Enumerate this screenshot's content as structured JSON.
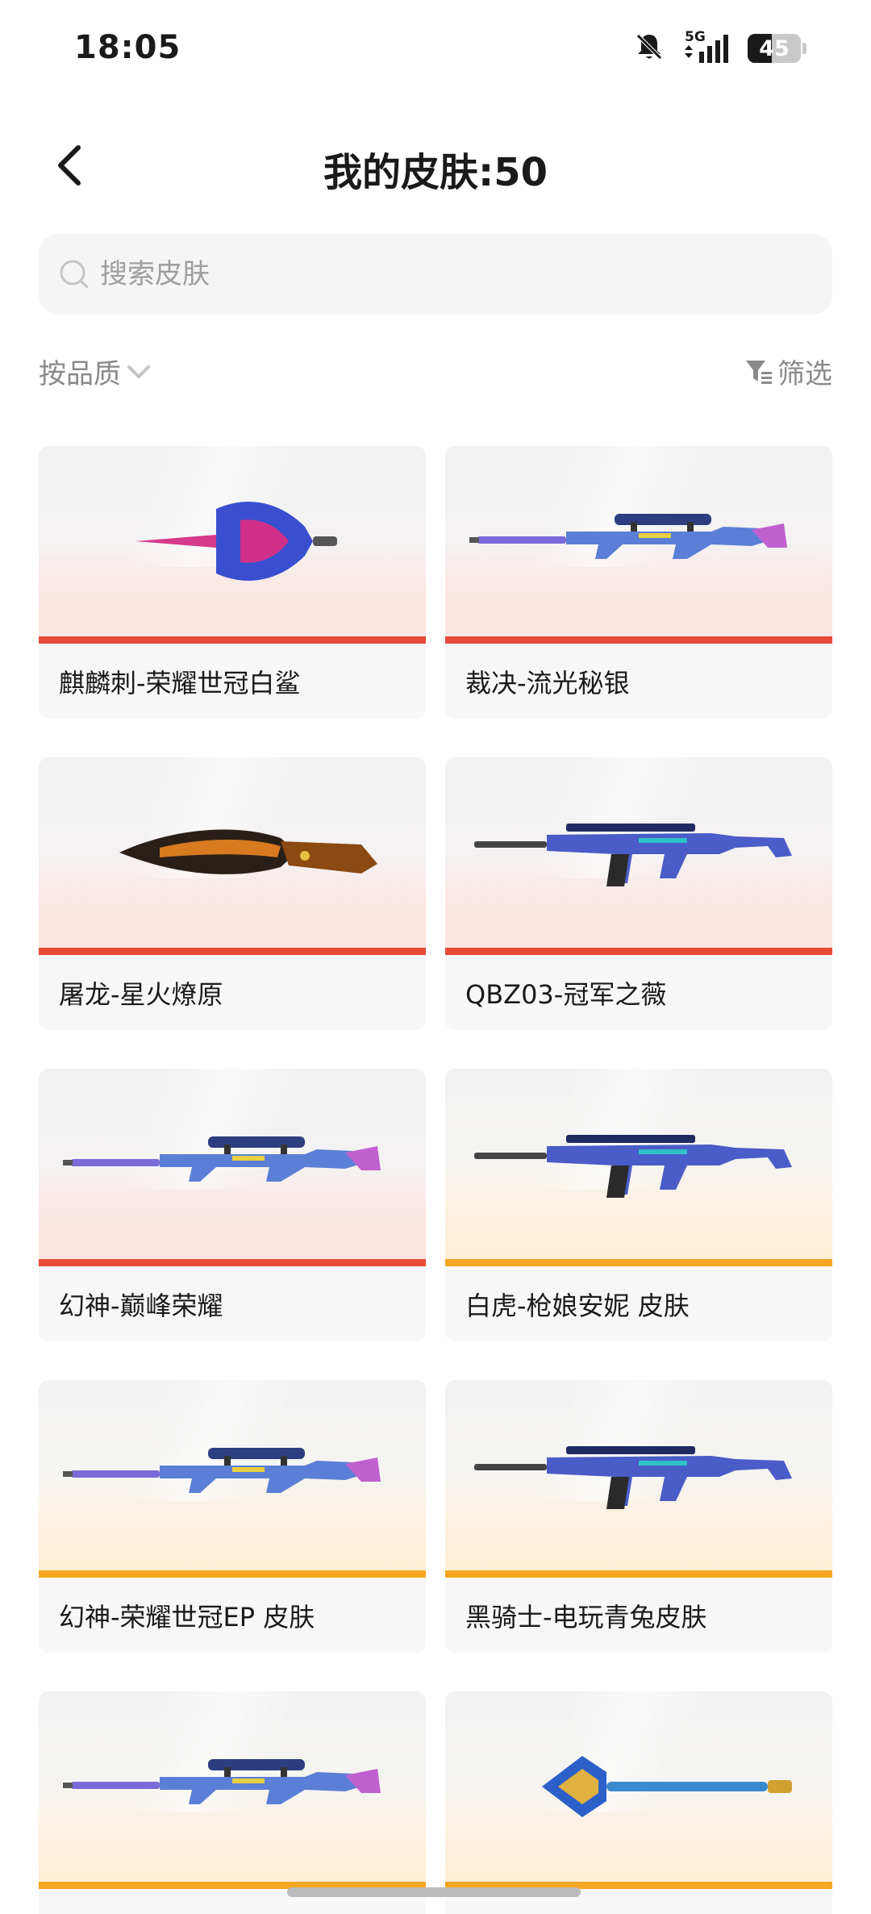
{
  "status_bar": {
    "time": "18:05",
    "network": "5G",
    "battery": 45,
    "icons": [
      "bell-off-icon",
      "signal-5g-icon",
      "battery-icon"
    ]
  },
  "header": {
    "title": "我的皮肤:50",
    "back_icon": "chevron-left-icon"
  },
  "search": {
    "placeholder": "搜索皮肤",
    "value": ""
  },
  "filters": {
    "sort_label": "按品质",
    "filter_label": "筛选"
  },
  "colors": {
    "rarity_red": "#e84a3a",
    "rarity_gold": "#f5a623"
  },
  "skins": [
    {
      "name": "麒麟刺-荣耀世冠白鲨",
      "rarity": "red",
      "weapon": "knuckle-dagger"
    },
    {
      "name": "裁决-流光秘银",
      "rarity": "red",
      "weapon": "sniper-rifle"
    },
    {
      "name": "屠龙-星火燎原",
      "rarity": "red",
      "weapon": "kukri-knife"
    },
    {
      "name": "QBZ03-冠军之薇",
      "rarity": "red",
      "weapon": "assault-rifle"
    },
    {
      "name": "幻神-巅峰荣耀",
      "rarity": "red",
      "weapon": "sniper-rifle"
    },
    {
      "name": "白虎-枪娘安妮 皮肤",
      "rarity": "gold",
      "weapon": "assault-rifle"
    },
    {
      "name": "幻神-荣耀世冠EP 皮肤",
      "rarity": "gold",
      "weapon": "sniper-rifle"
    },
    {
      "name": "黑骑士-电玩青兔皮肤",
      "rarity": "gold",
      "weapon": "assault-rifle"
    },
    {
      "name": "",
      "rarity": "gold",
      "weapon": "sniper-rifle"
    },
    {
      "name": "",
      "rarity": "gold",
      "weapon": "spear-knife"
    }
  ]
}
